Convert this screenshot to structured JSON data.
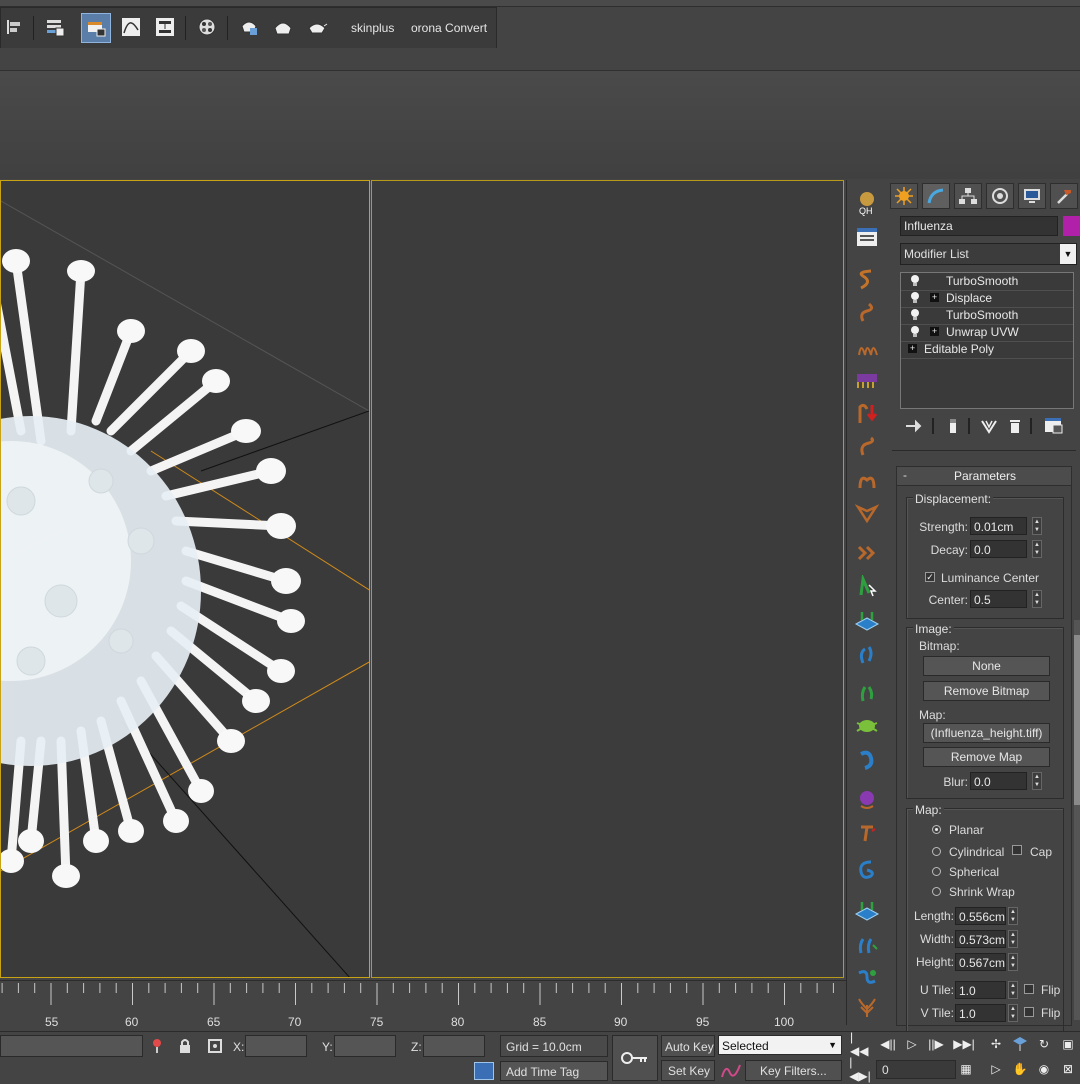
{
  "toolbar": {
    "skinplus_label": "skinplus",
    "corona_convert_label": "orona Convert"
  },
  "command_panel": {
    "object_name": "Influenza",
    "object_color": "#b020a8",
    "modifier_list_label": "Modifier List",
    "stack": [
      {
        "label": "TurboSmooth",
        "has_plus": false
      },
      {
        "label": "Displace",
        "has_plus": true
      },
      {
        "label": "TurboSmooth",
        "has_plus": false
      },
      {
        "label": "Unwrap UVW",
        "has_plus": true
      },
      {
        "label": "Editable Poly",
        "has_plus": true
      }
    ],
    "parameters": {
      "title": "Parameters",
      "displacement": {
        "title": "Displacement:",
        "strength_label": "Strength:",
        "strength_value": "0.01cm",
        "decay_label": "Decay:",
        "decay_value": "0.0",
        "luminance_center_label": "Luminance Center",
        "luminance_center_checked": true,
        "center_label": "Center:",
        "center_value": "0.5"
      },
      "image": {
        "title": "Image:",
        "bitmap_label": "Bitmap:",
        "bitmap_button": "None",
        "remove_bitmap_button": "Remove Bitmap",
        "map_label": "Map:",
        "map_button": "(Influenza_height.tiff)",
        "remove_map_button": "Remove Map",
        "blur_label": "Blur:",
        "blur_value": "0.0"
      },
      "map": {
        "title": "Map:",
        "planar_label": "Planar",
        "cylindrical_label": "Cylindrical",
        "cap_label": "Cap",
        "spherical_label": "Spherical",
        "shrink_wrap_label": "Shrink Wrap",
        "selected_mapping": "Planar",
        "length_label": "Length:",
        "length_value": "0.556cm",
        "width_label": "Width:",
        "width_value": "0.573cm",
        "height_label": "Height:",
        "height_value": "0.567cm",
        "utile_label": "U Tile:",
        "utile_value": "1.0",
        "vtile_label": "V Tile:",
        "vtile_value": "1.0",
        "flip_label": "Flip"
      }
    }
  },
  "timeline": {
    "ticks": [
      "55",
      "60",
      "65",
      "70",
      "75",
      "80",
      "85",
      "90",
      "95",
      "100"
    ]
  },
  "statusbar": {
    "x_label": "X:",
    "y_label": "Y:",
    "z_label": "Z:",
    "grid_text": "Grid = 10.0cm",
    "add_time_tag": "Add Time Tag",
    "auto_key": "Auto Key",
    "set_key": "Set Key",
    "selected_option": "Selected",
    "key_filters": "Key Filters...",
    "frame_value": "0"
  }
}
